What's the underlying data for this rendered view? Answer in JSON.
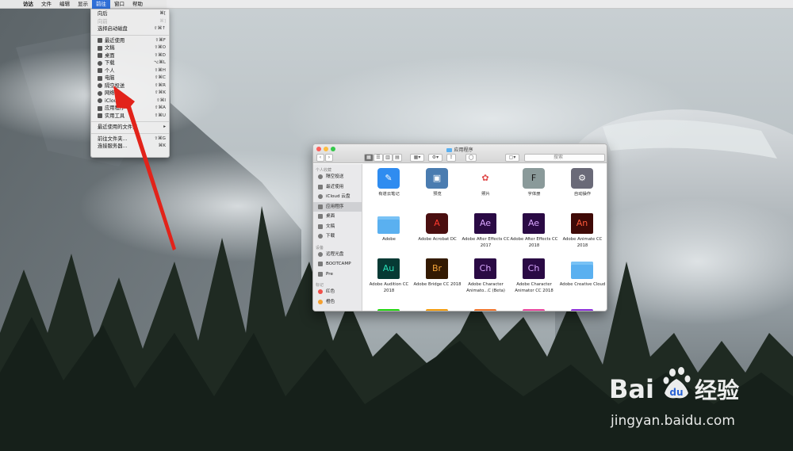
{
  "menubar": {
    "apple": "",
    "items": [
      {
        "label": "访达"
      },
      {
        "label": "文件"
      },
      {
        "label": "编辑"
      },
      {
        "label": "显示"
      },
      {
        "label": "前往"
      },
      {
        "label": "窗口"
      },
      {
        "label": "帮助"
      }
    ]
  },
  "go_menu": {
    "items": [
      {
        "label": "向后",
        "shortcut": "⌘[",
        "disabled": false
      },
      {
        "label": "向前",
        "shortcut": "⌘]",
        "disabled": true
      },
      {
        "label": "选择启动磁盘",
        "shortcut": "⇧⌘↑",
        "disabled": false
      },
      {
        "label": "最近使用",
        "shortcut": "⇧⌘F",
        "icon": "recents-icon"
      },
      {
        "label": "文稿",
        "shortcut": "⇧⌘O",
        "icon": "documents-icon"
      },
      {
        "label": "桌面",
        "shortcut": "⇧⌘D",
        "icon": "desktop-icon"
      },
      {
        "label": "下载",
        "shortcut": "⌥⌘L",
        "icon": "downloads-icon"
      },
      {
        "label": "个人",
        "shortcut": "⇧⌘H",
        "icon": "home-icon"
      },
      {
        "label": "电脑",
        "shortcut": "⇧⌘C",
        "icon": "computer-icon"
      },
      {
        "label": "隔空投送",
        "shortcut": "⇧⌘R",
        "icon": "airdrop-icon"
      },
      {
        "label": "网络",
        "shortcut": "⇧⌘K",
        "icon": "network-icon"
      },
      {
        "label": "iCloud 云盘",
        "shortcut": "⇧⌘I",
        "icon": "icloud-icon"
      },
      {
        "label": "应用程序",
        "shortcut": "⇧⌘A",
        "icon": "applications-icon"
      },
      {
        "label": "实用工具",
        "shortcut": "⇧⌘U",
        "icon": "utilities-icon"
      },
      {
        "label": "最近使用的文件夹",
        "shortcut": "▸"
      },
      {
        "label": "前往文件夹...",
        "shortcut": "⇧⌘G"
      },
      {
        "label": "连接服务器...",
        "shortcut": "⌘K"
      }
    ]
  },
  "finder": {
    "title": "应用程序",
    "search_placeholder": "搜索",
    "toolbar": {
      "back": "‹",
      "forward": "›",
      "view_icons": "▦",
      "view_list": "☰",
      "view_columns": "▥",
      "view_cover": "▤",
      "arrange": "▦▾",
      "action": "⚙▾",
      "share": "⇪",
      "tags": "◯",
      "path": "▢▾"
    },
    "sidebar": {
      "favorites_header": "个人收藏",
      "favorites": [
        "隔空投送",
        "最近使用",
        "iCloud 云盘",
        "应用程序",
        "桌面",
        "文稿",
        "下载"
      ],
      "devices_header": "设备",
      "devices": [
        "远程光盘",
        "BOOTCAMP",
        "Pre"
      ],
      "tags_header": "标记",
      "tags": [
        {
          "label": "红色",
          "color": "#f0504a"
        },
        {
          "label": "橙色",
          "color": "#f5a030"
        }
      ]
    },
    "apps": [
      {
        "label": "有道云笔记",
        "bg": "#2f8cf0",
        "fg": "#ffffff",
        "glyph": "✎"
      },
      {
        "label": "预览",
        "bg": "#4a7cb0",
        "fg": "#ffffff",
        "glyph": "▣"
      },
      {
        "label": "照片",
        "bg": "#ffffff",
        "fg": "#e04a4a",
        "glyph": "✿"
      },
      {
        "label": "字体册",
        "bg": "#8a9a9a",
        "fg": "#1a1a1a",
        "glyph": "F"
      },
      {
        "label": "自动操作",
        "bg": "#6a6a78",
        "fg": "#ffffff",
        "glyph": "⚙"
      },
      {
        "label": "Adobe",
        "bg": "#5ab0f0",
        "fg": "#ffffff",
        "glyph": ""
      },
      {
        "label": "Adobe Acrobat DC",
        "bg": "#4a0f10",
        "fg": "#ff3a2e",
        "glyph": "A"
      },
      {
        "label": "Adobe After Effects CC 2017",
        "bg": "#2a0a44",
        "fg": "#d9a6ff",
        "glyph": "Ae"
      },
      {
        "label": "Adobe After Effects CC 2018",
        "bg": "#2a0a44",
        "fg": "#d9a6ff",
        "glyph": "Ae"
      },
      {
        "label": "Adobe Animate CC 2018",
        "bg": "#3f0a07",
        "fg": "#ff5a3a",
        "glyph": "An"
      },
      {
        "label": "Adobe Audition CC 2018",
        "bg": "#063a34",
        "fg": "#29e0b8",
        "glyph": "Au"
      },
      {
        "label": "Adobe Bridge CC 2018",
        "bg": "#331a02",
        "fg": "#f2a33a",
        "glyph": "Br"
      },
      {
        "label": "Adobe Character Animato...C (Beta)",
        "bg": "#2a0a44",
        "fg": "#d9a6ff",
        "glyph": "Ch"
      },
      {
        "label": "Adobe Character Animator CC 2018",
        "bg": "#2a0a44",
        "fg": "#d9a6ff",
        "glyph": "Ch"
      },
      {
        "label": "Adobe Creative Cloud",
        "bg": "#5ab0f0",
        "fg": "#ffffff",
        "glyph": ""
      }
    ],
    "partial_row_colors": [
      "#1fd40c",
      "#f29a0a",
      "#f0732a",
      "#e8449c",
      "#8a2cd8"
    ]
  },
  "watermark": {
    "logo_text": "Bai du 经验",
    "url": "jingyan.baidu.com"
  },
  "colors": {
    "menu_highlight": "#2f6fd8",
    "arrow": "#e2231a"
  }
}
